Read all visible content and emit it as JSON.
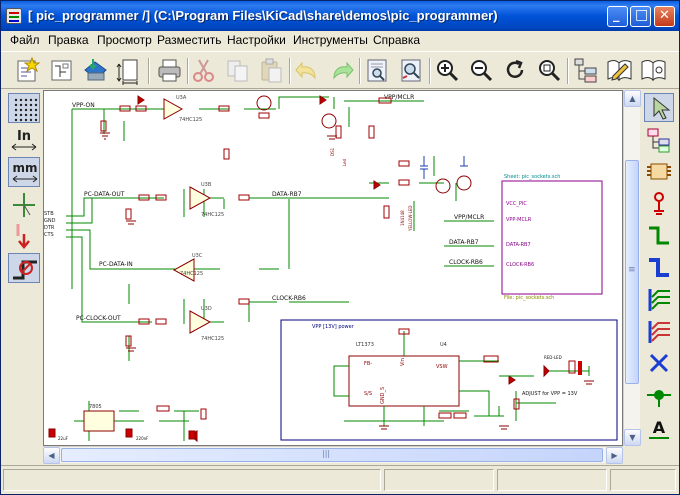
{
  "window": {
    "title": "[ pic_programmer /] (C:\\Program Files\\KiCad\\share\\demos\\pic_programmer)",
    "minimize_glyph": "_",
    "maximize_glyph": "□",
    "close_glyph": "✕"
  },
  "menu": {
    "items": [
      "Файл",
      "Правка",
      "Просмотр",
      "Разместить",
      "Настройки",
      "Инструменты",
      "Справка"
    ]
  },
  "toolbar": {
    "icons": [
      "new-schematic-icon",
      "new-sheet-icon",
      "save-icon",
      "page-settings-icon",
      "print-icon",
      "cut-icon",
      "copy-icon",
      "paste-icon",
      "undo-icon",
      "redo-icon",
      "find-icon",
      "find-replace-icon",
      "zoom-in-icon",
      "zoom-out-icon",
      "zoom-redraw-icon",
      "zoom-fit-icon",
      "hierarchy-navigator-icon",
      "library-editor-icon",
      "library-browser-icon"
    ]
  },
  "left_toolbar": {
    "grid_icon": "grid-toggle-icon",
    "units_in_label": "In",
    "units_mm_label": "mm",
    "cursor_icon": "cursor-shape-icon",
    "hidden_pins_icon": "hidden-pins-icon",
    "bus_wire_icon": "bus-wire-angle-icon"
  },
  "right_toolbar": {
    "tools": [
      "select-tool-icon",
      "hierarchy-tool-icon",
      "component-tool-icon",
      "power-port-tool-icon",
      "wire-tool-icon",
      "bus-tool-icon",
      "wire-to-bus-entry-icon",
      "bus-to-bus-entry-icon",
      "no-connect-icon",
      "junction-icon",
      "label-tool-icon"
    ],
    "label_glyph": "A"
  },
  "schematic": {
    "nets": [
      "VPP-ON",
      "PC-DATA-OUT",
      "PC-DATA-IN",
      "PC-CLOCK-OUT",
      "DATA-RB7",
      "CLOCK-RB6",
      "VPP/MCLR",
      "VCC_PIC",
      "VPP/MCLR",
      "DATA-RB7",
      "CLOCK-RB6"
    ],
    "sheet_name": "Sheet: pic_sockets.sch",
    "sheet_file": "File: pic_sockets.sch",
    "sheet_pins": [
      "VCC_PIC",
      "VPP-MCLR",
      "DATA-RB7",
      "CLOCK-RB6"
    ],
    "power_box_title": "VPP [13V] power",
    "regulator": "LT1373",
    "regulator_ref": "U4",
    "regulator_pins": [
      "FB-",
      "FB+",
      "S/S",
      "Vin",
      "VSW",
      "GND_S",
      "GND"
    ],
    "adjust_note": "ADJUST for VPP = 13V",
    "led_label": "RED-LED",
    "gates": [
      "U3A",
      "U3B",
      "U3C",
      "U3D"
    ],
    "gate_type": "74HC125",
    "regulator2": "7805",
    "caps": [
      "22uF",
      "220nF",
      "22uF"
    ],
    "connector_pins": [
      "STB",
      "GND",
      "DTR",
      "CTS",
      "RTS"
    ]
  },
  "scrollbars": {
    "up": "▲",
    "down": "▼",
    "left": "◀",
    "right": "▶",
    "grip": "≡",
    "hgrip": "|||"
  },
  "status": {
    "fields": [
      "",
      "",
      "",
      ""
    ]
  }
}
